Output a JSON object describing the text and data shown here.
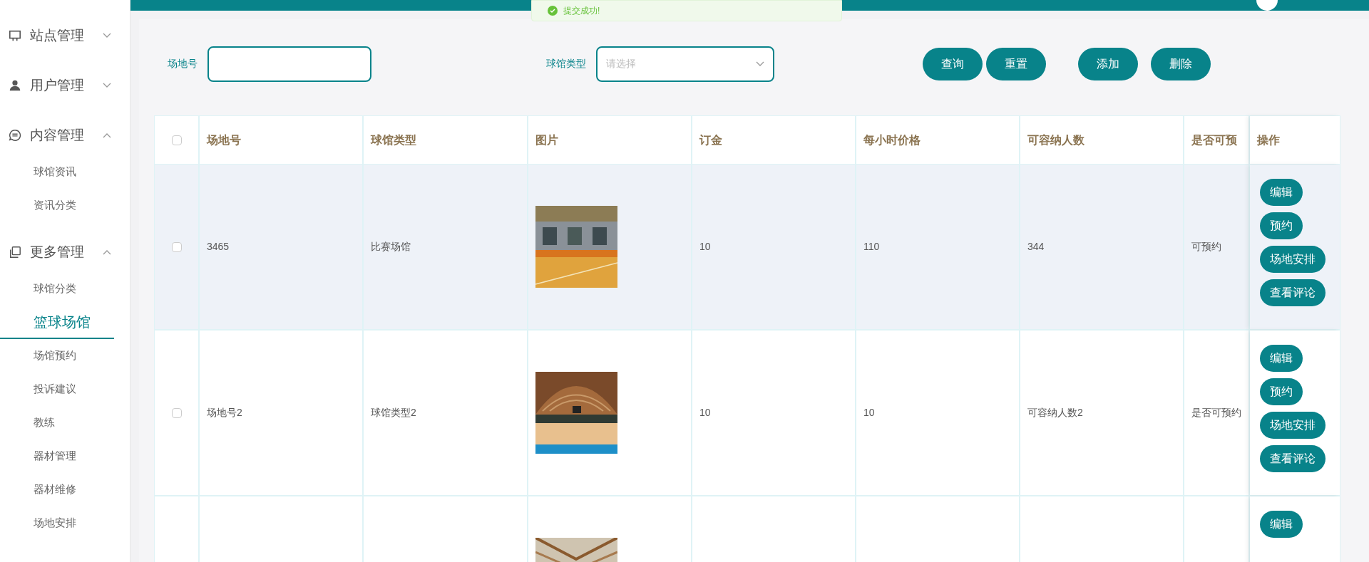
{
  "toast": {
    "message": "提交成功!"
  },
  "sidebar": {
    "items": [
      {
        "label": "站点管理",
        "expanded": false
      },
      {
        "label": "用户管理",
        "expanded": false
      },
      {
        "label": "内容管理",
        "expanded": true,
        "children": [
          {
            "label": "球馆资讯",
            "selected": false
          },
          {
            "label": "资讯分类",
            "selected": false
          }
        ]
      },
      {
        "label": "更多管理",
        "expanded": true,
        "children": [
          {
            "label": "球馆分类",
            "selected": false
          },
          {
            "label": "篮球场馆",
            "selected": true
          },
          {
            "label": "场馆预约",
            "selected": false
          },
          {
            "label": "投诉建议",
            "selected": false
          },
          {
            "label": "教练",
            "selected": false
          },
          {
            "label": "器材管理",
            "selected": false
          },
          {
            "label": "器材维修",
            "selected": false
          },
          {
            "label": "场地安排",
            "selected": false
          }
        ]
      }
    ]
  },
  "search": {
    "fields": [
      {
        "kind": "text",
        "label": "场地号"
      },
      {
        "kind": "select",
        "label": "球馆类型",
        "placeholder": "请选择"
      }
    ],
    "query_buttons": [
      "查询",
      "重置"
    ],
    "action_buttons": [
      "添加",
      "删除"
    ]
  },
  "table": {
    "all_checked": false,
    "columns": [
      "场地号",
      "球馆类型",
      "图片",
      "订金",
      "每小时价格",
      "可容纳人数",
      "是否可预",
      "操作"
    ],
    "rows": [
      {
        "highlighted": true,
        "checked": false,
        "cells": [
          "3465",
          "比赛场馆",
          {
            "kind": "picture"
          },
          "10",
          "110",
          "344",
          "可预约"
        ],
        "actions": [
          "编辑",
          "预约",
          "场地安排",
          "查看评论"
        ]
      },
      {
        "highlighted": false,
        "checked": false,
        "cells": [
          "场地号2",
          "球馆类型2",
          {
            "kind": "picture"
          },
          "10",
          "10",
          "可容纳人数2",
          "是否可预约"
        ],
        "actions": [
          "编辑",
          "预约",
          "场地安排",
          "查看评论"
        ]
      },
      {
        "cells": [
          null,
          null,
          {
            "kind": "picture"
          }
        ],
        "actions": [
          "编辑"
        ]
      }
    ]
  }
}
